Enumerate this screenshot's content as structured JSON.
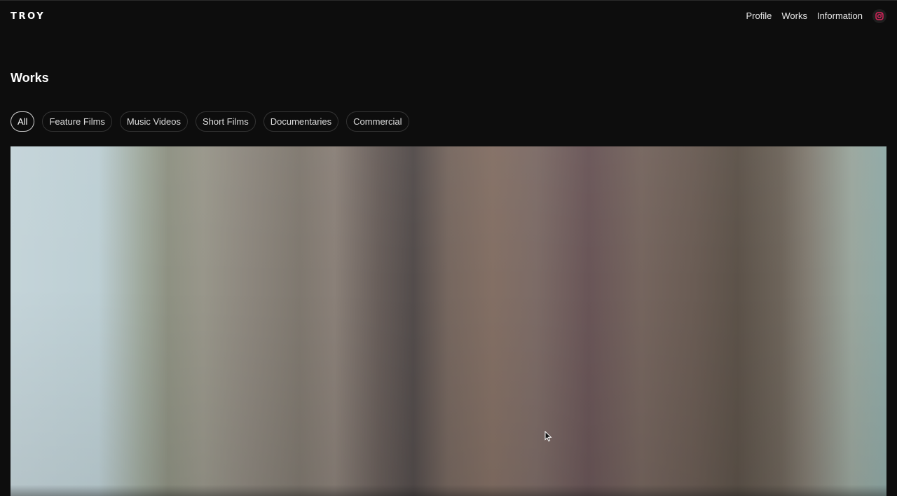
{
  "header": {
    "logo": "TROY",
    "nav": [
      {
        "label": "Profile"
      },
      {
        "label": "Works"
      },
      {
        "label": "Information"
      }
    ],
    "social_icon": "instagram-icon",
    "social_icon_color": "#e0245e"
  },
  "main": {
    "title": "Works",
    "filters": [
      {
        "label": "All",
        "active": true
      },
      {
        "label": "Feature Films",
        "active": false
      },
      {
        "label": "Music Videos",
        "active": false
      },
      {
        "label": "Short Films",
        "active": false
      },
      {
        "label": "Documentaries",
        "active": false
      },
      {
        "label": "Commercial",
        "active": false
      }
    ]
  },
  "colors": {
    "background": "#0d0d0d",
    "text": "#ffffff",
    "pill_border": "#333333",
    "pill_active_border": "#cfcfcf"
  }
}
